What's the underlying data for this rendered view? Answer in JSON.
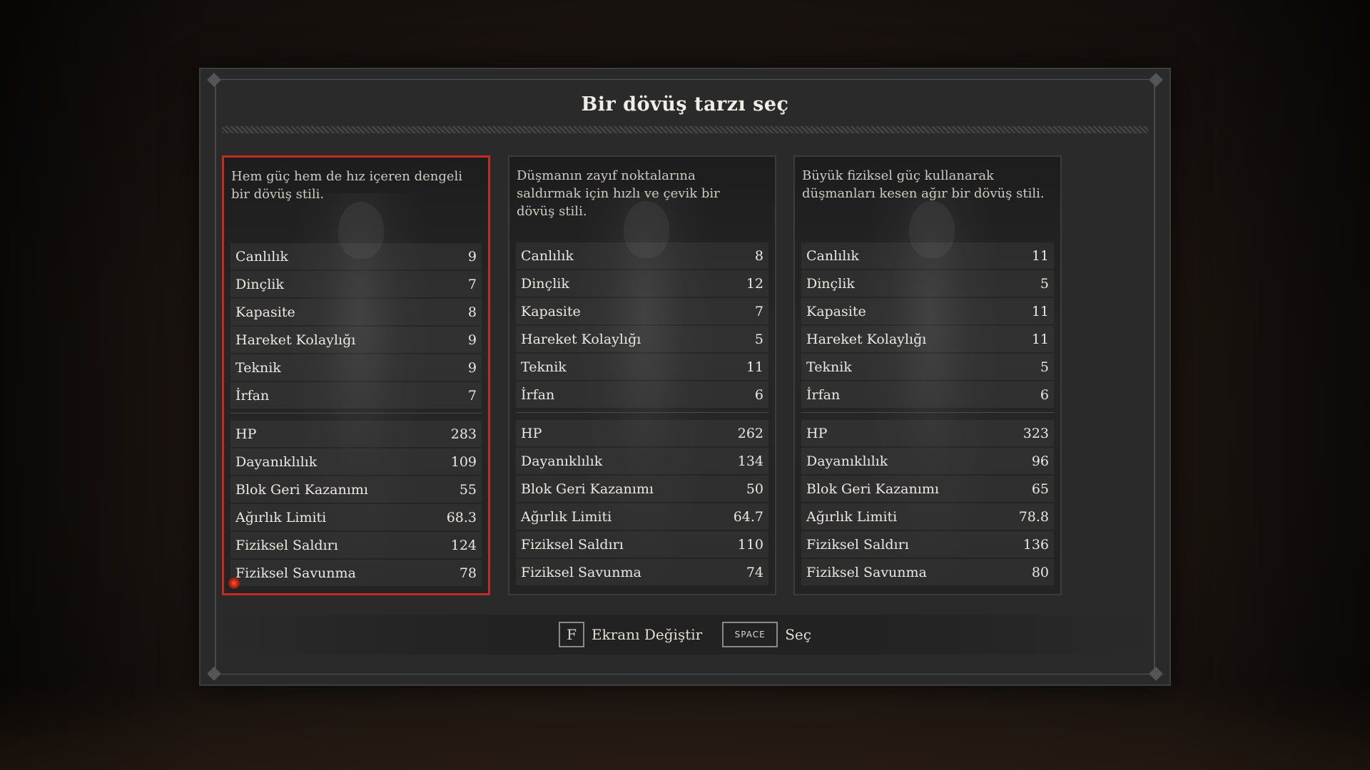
{
  "title": "Bir dövüş tarzı seç",
  "cards": [
    {
      "description": "Hem güç hem de hız içeren dengeli bir dövüş stili.",
      "selected": true,
      "attributes": [
        {
          "label": "Canlılık",
          "value": "9"
        },
        {
          "label": "Dinçlik",
          "value": "7"
        },
        {
          "label": "Kapasite",
          "value": "8"
        },
        {
          "label": "Hareket Kolaylığı",
          "value": "9"
        },
        {
          "label": "Teknik",
          "value": "9"
        },
        {
          "label": "İrfan",
          "value": "7"
        }
      ],
      "derived": [
        {
          "label": "HP",
          "value": "283"
        },
        {
          "label": "Dayanıklılık",
          "value": "109"
        },
        {
          "label": "Blok Geri Kazanımı",
          "value": "55"
        },
        {
          "label": "Ağırlık Limiti",
          "value": "68.3"
        },
        {
          "label": "Fiziksel Saldırı",
          "value": "124"
        },
        {
          "label": "Fiziksel Savunma",
          "value": "78"
        }
      ]
    },
    {
      "description": "Düşmanın zayıf noktalarına saldırmak için hızlı ve çevik bir dövüş stili.",
      "selected": false,
      "attributes": [
        {
          "label": "Canlılık",
          "value": "8"
        },
        {
          "label": "Dinçlik",
          "value": "12"
        },
        {
          "label": "Kapasite",
          "value": "7"
        },
        {
          "label": "Hareket Kolaylığı",
          "value": "5"
        },
        {
          "label": "Teknik",
          "value": "11"
        },
        {
          "label": "İrfan",
          "value": "6"
        }
      ],
      "derived": [
        {
          "label": "HP",
          "value": "262"
        },
        {
          "label": "Dayanıklılık",
          "value": "134"
        },
        {
          "label": "Blok Geri Kazanımı",
          "value": "50"
        },
        {
          "label": "Ağırlık Limiti",
          "value": "64.7"
        },
        {
          "label": "Fiziksel Saldırı",
          "value": "110"
        },
        {
          "label": "Fiziksel Savunma",
          "value": "74"
        }
      ]
    },
    {
      "description": "Büyük fiziksel güç kullanarak düşmanları kesen ağır bir dövüş stili.",
      "selected": false,
      "attributes": [
        {
          "label": "Canlılık",
          "value": "11"
        },
        {
          "label": "Dinçlik",
          "value": "5"
        },
        {
          "label": "Kapasite",
          "value": "11"
        },
        {
          "label": "Hareket Kolaylığı",
          "value": "11"
        },
        {
          "label": "Teknik",
          "value": "5"
        },
        {
          "label": "İrfan",
          "value": "6"
        }
      ],
      "derived": [
        {
          "label": "HP",
          "value": "323"
        },
        {
          "label": "Dayanıklılık",
          "value": "96"
        },
        {
          "label": "Blok Geri Kazanımı",
          "value": "65"
        },
        {
          "label": "Ağırlık Limiti",
          "value": "78.8"
        },
        {
          "label": "Fiziksel Saldırı",
          "value": "136"
        },
        {
          "label": "Fiziksel Savunma",
          "value": "80"
        }
      ]
    }
  ],
  "footer": {
    "switch_key": "F",
    "switch_label": "Ekranı Değiştir",
    "select_key": "SPACE",
    "select_label": "Seç"
  },
  "colors": {
    "selected_border": "#c22a24",
    "panel_bg": "#2a2a2a"
  }
}
